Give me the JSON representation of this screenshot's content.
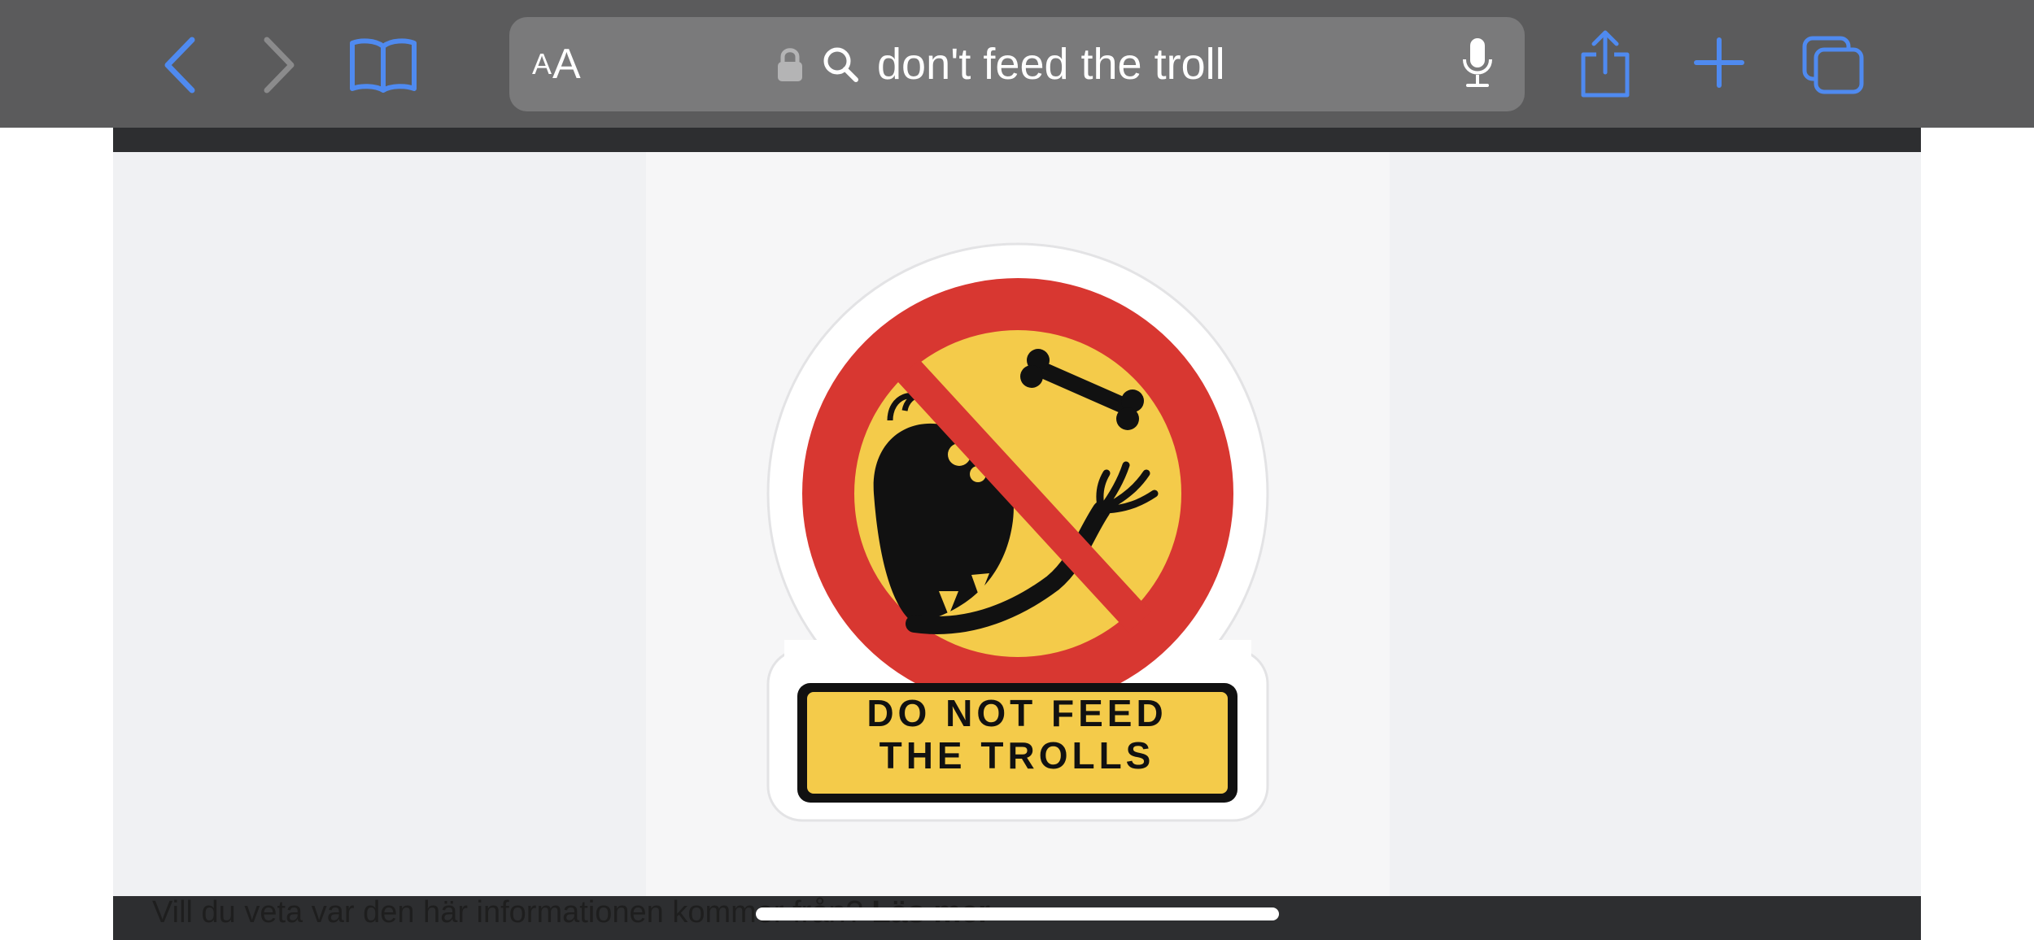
{
  "toolbar": {
    "back_icon": "chevron-left-icon",
    "forward_icon": "chevron-right-icon",
    "bookmarks_icon": "book-icon",
    "reader_label": "AA",
    "reader_label_small": "A",
    "reader_label_large": "A",
    "lock_icon": "lock-icon",
    "search_icon": "magnifier-icon",
    "address_text": "don't feed the troll",
    "mic_icon": "microphone-icon",
    "share_icon": "share-icon",
    "new_tab_icon": "plus-icon",
    "tabs_icon": "tabs-icon",
    "accent_color": "#4f8af0"
  },
  "content": {
    "sign_text_line1": "DO NOT FEED",
    "sign_text_line2": "THE TROLLS",
    "sign_red": "#d83731",
    "sign_yellow": "#f4cb4a",
    "info_text_prefix": "Vill du veta var den här informationen kommer från?",
    "info_link": "Läs mer"
  }
}
